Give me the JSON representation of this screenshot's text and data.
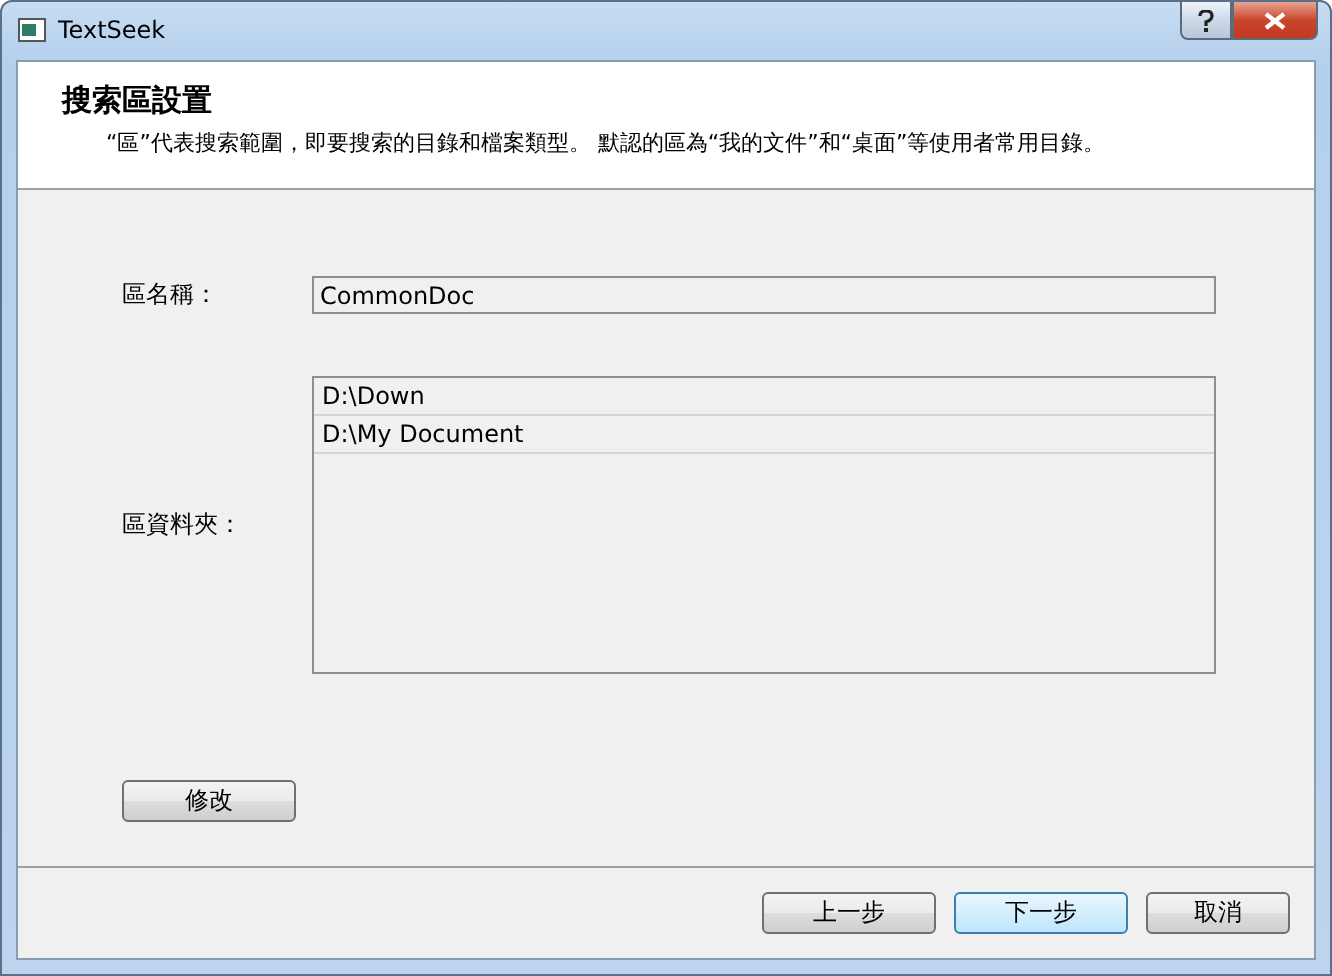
{
  "window": {
    "title": "TextSeek"
  },
  "header": {
    "title": "搜索區設置",
    "description": "“區”代表搜索範圍，即要搜索的目錄和檔案類型。 默認的區為“我的文件”和“桌面”等使用者常用目錄。"
  },
  "form": {
    "name_label": "區名稱：",
    "name_value": "CommonDoc",
    "folders_label": "區資料夾：",
    "folders": [
      {
        "path": "D:\\Down",
        "selected": false
      },
      {
        "path": "D:\\My Document",
        "selected": false
      }
    ],
    "modify_button": "修改"
  },
  "buttons": [
    {
      "label": "上一步",
      "default": false
    },
    {
      "label": "下一步",
      "default": true
    },
    {
      "label": "取消",
      "default": false
    }
  ]
}
